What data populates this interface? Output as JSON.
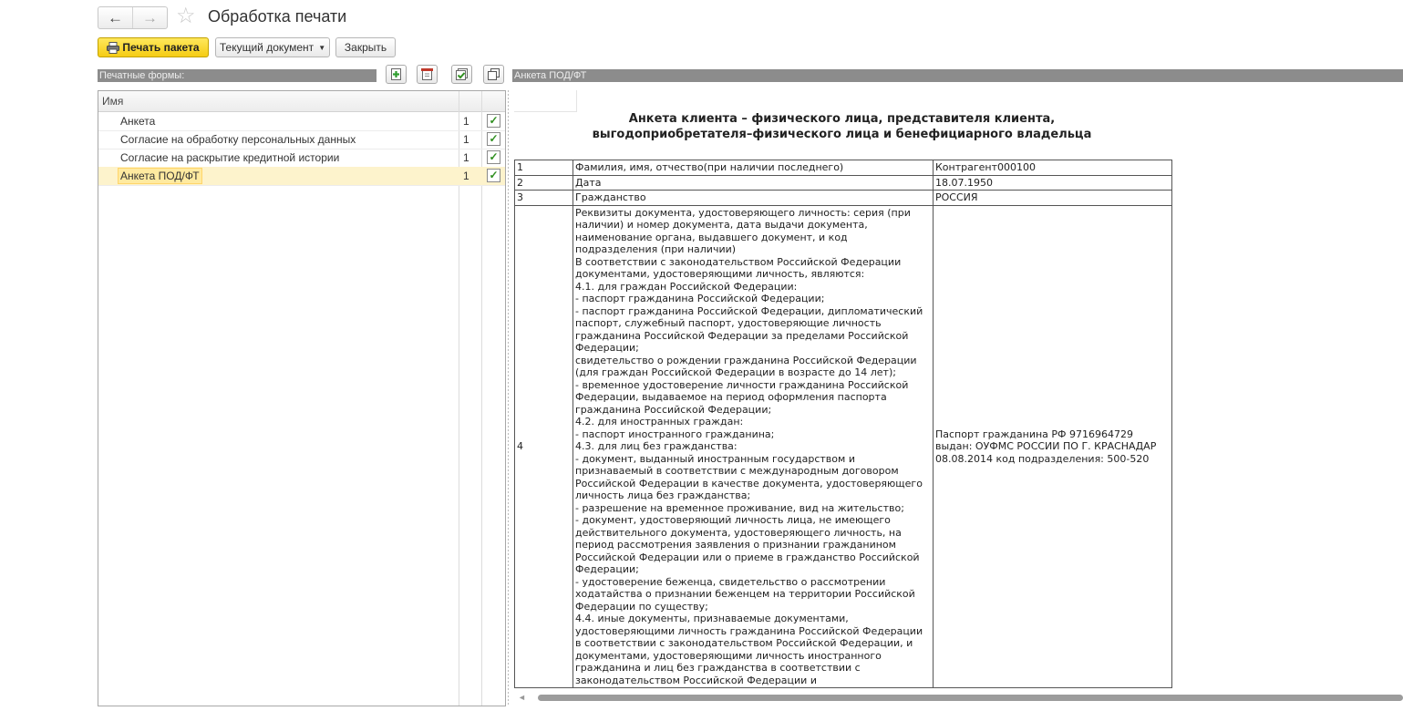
{
  "window": {
    "title": "Обработка печати"
  },
  "nav": {
    "back": "←",
    "forward": "→",
    "star": "☆"
  },
  "toolbar": {
    "print_package": "Печать пакета",
    "current_document": "Текущий документ",
    "close": "Закрыть"
  },
  "left_panel": {
    "header": "Печатные формы:",
    "column_name": "Имя",
    "icons": [
      "add-form-icon",
      "delete-form-icon",
      "check-all-icon",
      "copy-icon"
    ],
    "rows": [
      {
        "name": "Анкета",
        "count": "1",
        "checked": true
      },
      {
        "name": "Согласие на обработку персональных данных",
        "count": "1",
        "checked": true
      },
      {
        "name": "Согласие на раскрытие кредитной истории",
        "count": "1",
        "checked": true
      },
      {
        "name": "Анкета ПОД/ФТ",
        "count": "1",
        "checked": true
      }
    ],
    "selected_index": 3
  },
  "right_panel": {
    "header": "Анкета ПОД/ФТ",
    "document": {
      "title_line1": "Анкета клиента – физического лица, представителя клиента,",
      "title_line2": "выгодоприобретателя–физического лица и бенефициарного владельца",
      "rows": [
        {
          "num": "1",
          "field": "Фамилия, имя, отчество(при наличии последнего)",
          "value": "Контрагент000100"
        },
        {
          "num": "2",
          "field": "Дата",
          "value": "18.07.1950"
        },
        {
          "num": "3",
          "field": "Гражданство",
          "value": "РОССИЯ"
        },
        {
          "num": "4",
          "field": "Реквизиты документа, удостоверяющего личность: серия (при наличии) и номер документа, дата выдачи документа, наименование органа, выдавшего документ, и код подразделения (при наличии)\nВ соответствии с законодательством Российской Федерации документами, удостоверяющими личность, являются:\n4.1. для граждан Российской Федерации:\n- паспорт гражданина Российской Федерации;\n- паспорт гражданина Российской Федерации, дипломатический паспорт, служебный паспорт, удостоверяющие личность гражданина Российской Федерации за пределами Российской Федерации;\nсвидетельство о рождении гражданина Российской Федерации (для граждан Российской Федерации в возрасте до 14 лет);\n- временное удостоверение личности гражданина Российской Федерации, выдаваемое на период оформления паспорта гражданина Российской Федерации;\n4.2. для иностранных граждан:\n- паспорт иностранного гражданина;\n4.3. для лиц без гражданства:\n- документ, выданный иностранным государством и признаваемый в соответствии с международным договором Российской Федерации в качестве документа, удостоверяющего личность лица без гражданства;\n- разрешение на временное проживание, вид на жительство;\n- документ, удостоверяющий личность лица, не имеющего действительного документа, удостоверяющего личность, на период рассмотрения заявления о признании гражданином Российской Федерации или о приеме в гражданство Российской Федерации;\n- удостоверение беженца, свидетельство о рассмотрении ходатайства о признании беженцем на территории Российской Федерации по существу;\n4.4. иные документы, признаваемые документами, удостоверяющими личность гражданина Российской Федерации в соответствии с законодательством Российской Федерации, и документами, удостоверяющими личность иностранного гражданина и лиц без гражданства в соответствии с законодательством Российской Федерации и",
          "value": "Паспорт гражданина РФ 9716964729 выдан: ОУФМС РОССИИ ПО Г. КРАСНАДАР 08.08.2014 код подразделения: 500-520"
        }
      ]
    }
  },
  "colors": {
    "primary_button": "#f5cc14",
    "panel_header": "#8c8c8c",
    "selected_row": "#fdf3cc",
    "check": "#2f8f1f"
  }
}
